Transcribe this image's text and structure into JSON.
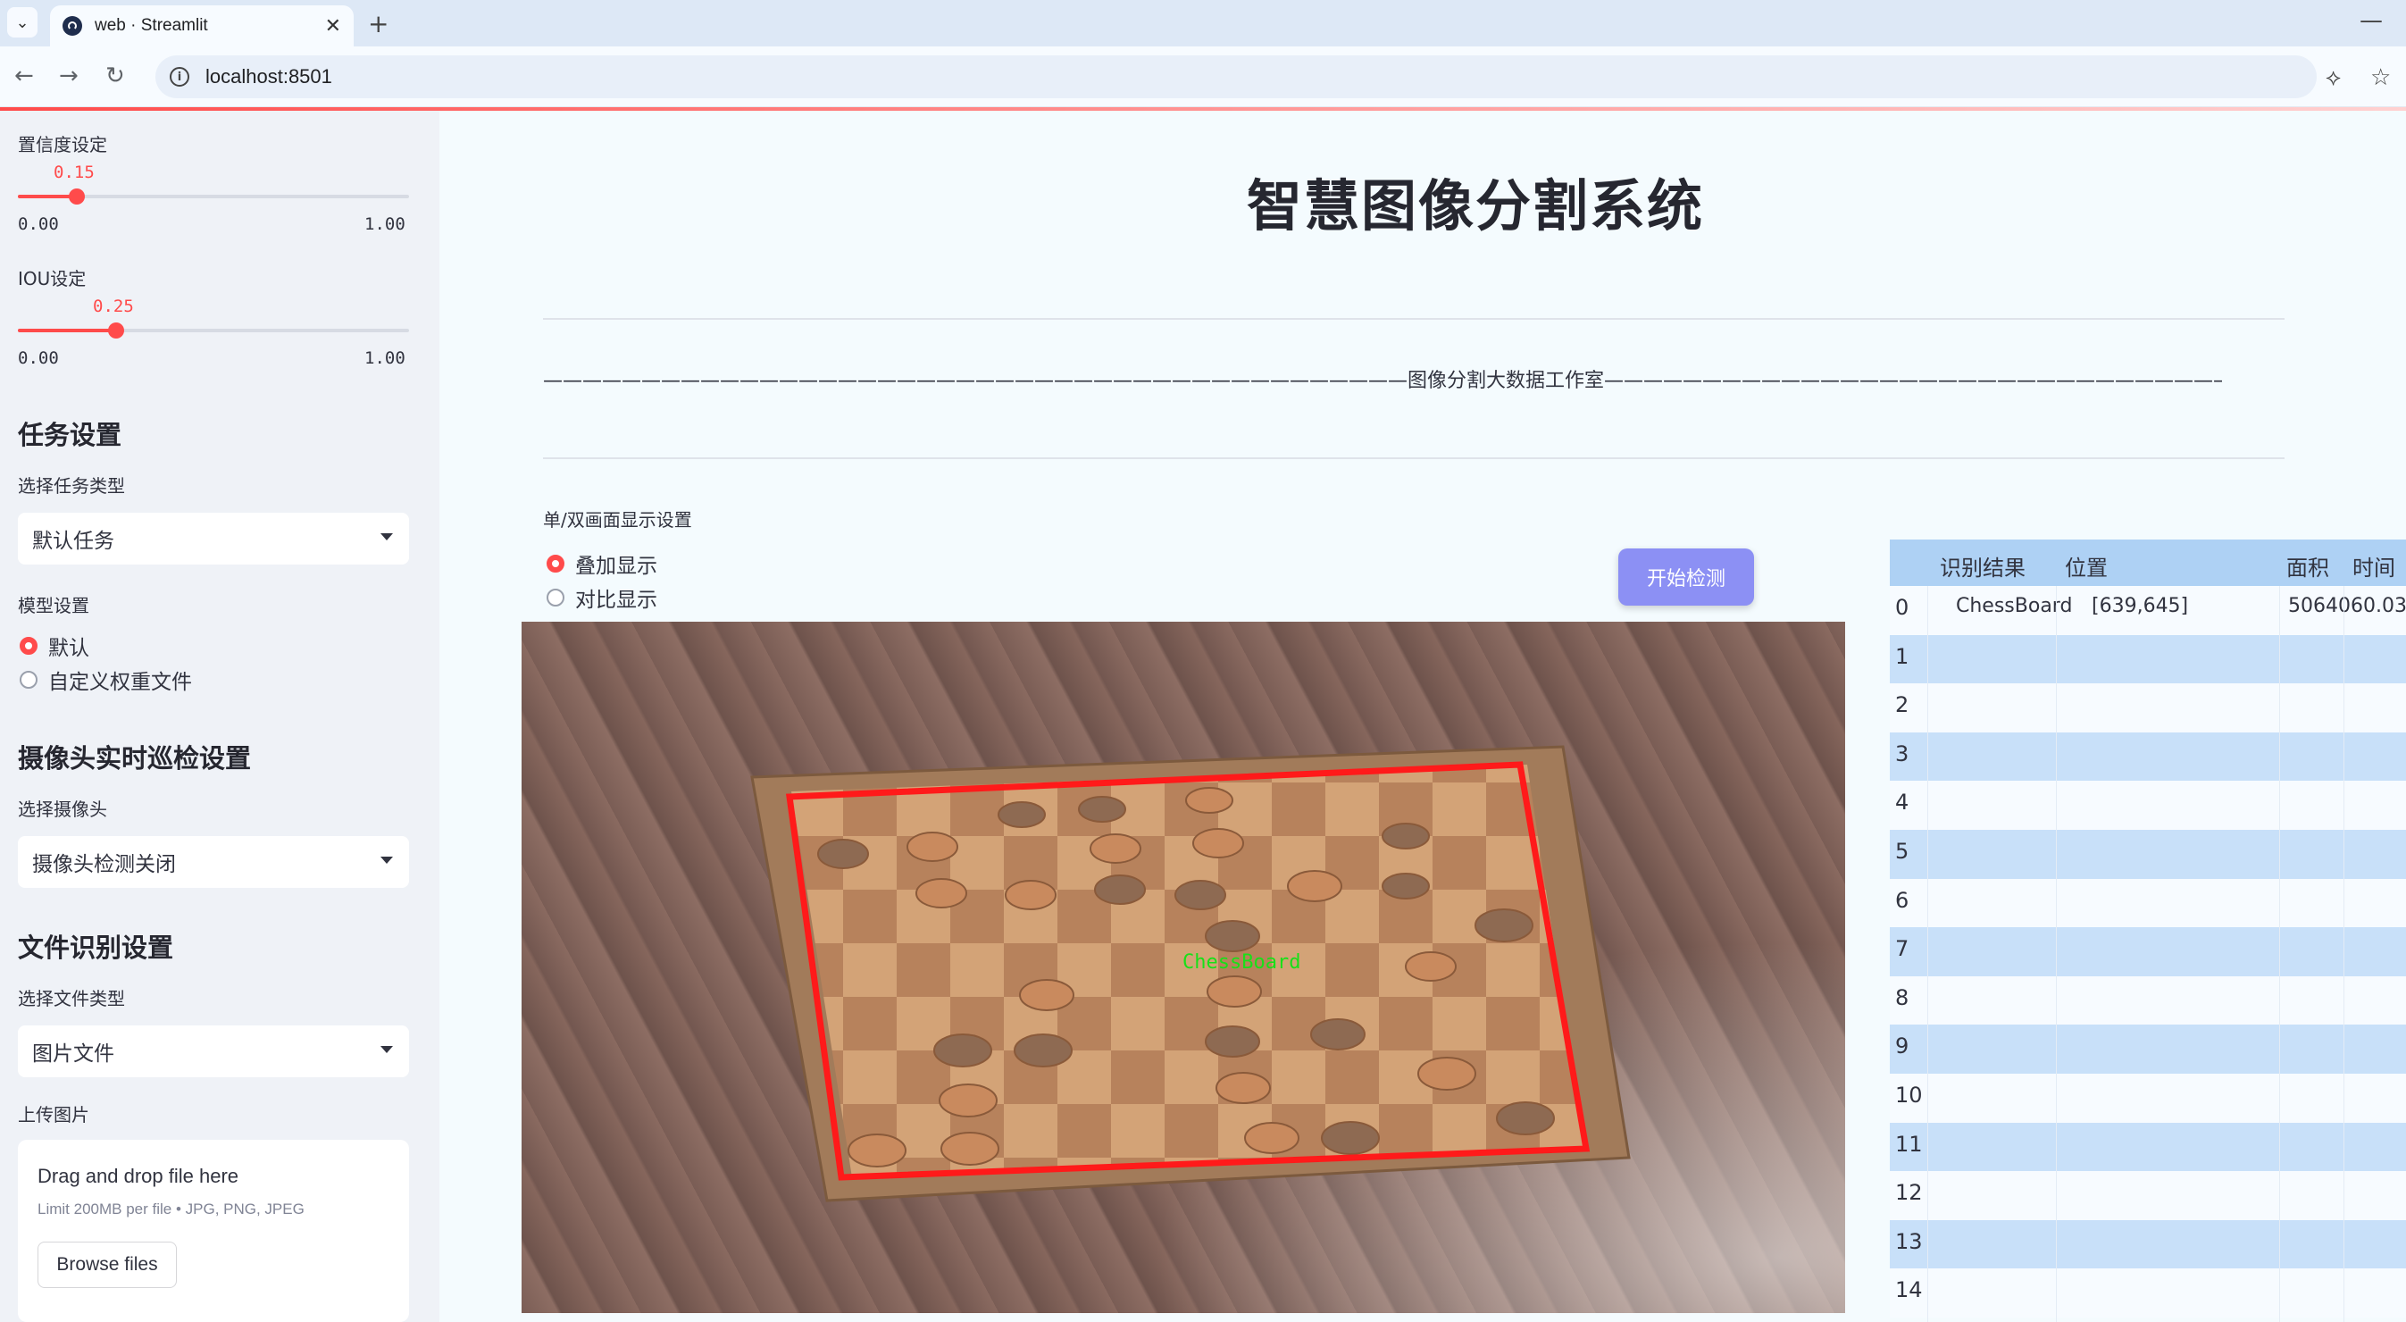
{
  "browser": {
    "tab_title": "web · Streamlit",
    "url": "localhost:8501"
  },
  "sidebar": {
    "conf": {
      "label": "置信度设定",
      "value": "0.15",
      "min": "0.00",
      "max": "1.00",
      "fraction": 0.15
    },
    "iou": {
      "label": "IOU设定",
      "value": "0.25",
      "min": "0.00",
      "max": "1.00",
      "fraction": 0.25
    },
    "task_heading": "任务设置",
    "task_type_label": "选择任务类型",
    "task_type_value": "默认任务",
    "model_label": "模型设置",
    "model_options": [
      "默认",
      "自定义权重文件"
    ],
    "model_selected": 0,
    "camera_heading": "摄像头实时巡检设置",
    "camera_label": "选择摄像头",
    "camera_value": "摄像头检测关闭",
    "file_heading": "文件识别设置",
    "file_type_label": "选择文件类型",
    "file_type_value": "图片文件",
    "upload_label": "上传图片",
    "upload_title": "Drag and drop file here",
    "upload_limit": "Limit 200MB per file • JPG, PNG, JPEG",
    "browse_label": "Browse files"
  },
  "main": {
    "title": "智慧图像分割系统",
    "banner": "————————————————————————————————————————————图像分割大数据工作室————————————————————————————————————————————",
    "display_label": "单/双画面显示设置",
    "display_options": [
      "叠加显示",
      "对比显示"
    ],
    "display_selected": 0,
    "detect_button": "开始检测",
    "detection_label": "ChessBoard",
    "colors": {
      "accent": "#ff4b4b",
      "button": "#8c90f4",
      "box": "#ff1a1a",
      "box_label": "#18e018"
    }
  },
  "table": {
    "columns": [
      "识别结果",
      "位置",
      "面积",
      "时间"
    ],
    "row_indices": [
      "0",
      "1",
      "2",
      "3",
      "4",
      "5",
      "6",
      "7",
      "8",
      "9",
      "10",
      "11",
      "12",
      "13",
      "14"
    ],
    "rows": [
      {
        "result": "ChessBoard",
        "position": "[639,645]",
        "area": "5064060.03",
        "time": ""
      }
    ]
  }
}
